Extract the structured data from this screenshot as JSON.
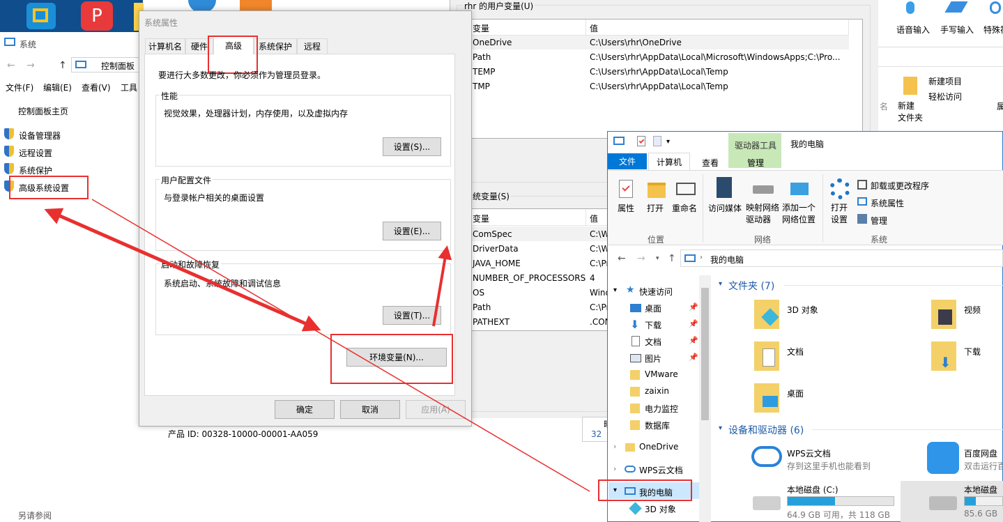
{
  "desktop": {
    "icons": [
      "desktop-app-1",
      "desktop-app-2",
      "desktop-app-3",
      "desktop-app-4",
      "desktop-app-5"
    ]
  },
  "ime": {
    "voice": "语音输入",
    "handwrite": "手写输入",
    "special": "特殊符"
  },
  "system_window": {
    "title": "系统",
    "address": "控制面板",
    "menu": [
      "文件(F)",
      "编辑(E)",
      "查看(V)",
      "工具"
    ],
    "home": "控制面板主页",
    "links": [
      "设备管理器",
      "远程设置",
      "系统保护",
      "高级系统设置"
    ],
    "product_id": "产品 ID: 00328-10000-00001-AA059",
    "see_also": "另请参阅"
  },
  "sysprops": {
    "title": "系统属性",
    "tabs": [
      "计算机名",
      "硬件",
      "高级",
      "系统保护",
      "远程"
    ],
    "admin_note": "要进行大多数更改，你必须作为管理员登录。",
    "perf": {
      "title": "性能",
      "desc": "视觉效果，处理器计划，内存使用，以及虚拟内存",
      "btn": "设置(S)..."
    },
    "profile": {
      "title": "用户配置文件",
      "desc": "与登录帐户相关的桌面设置",
      "btn": "设置(E)..."
    },
    "startup": {
      "title": "启动和故障恢复",
      "desc": "系统启动、系统故障和调试信息",
      "btn": "设置(T)..."
    },
    "env_btn": "环境变量(N)...",
    "ok": "确定",
    "cancel": "取消",
    "apply": "应用(A)"
  },
  "envvars": {
    "user_title": "rhr 的用户变量(U)",
    "col_var": "变量",
    "col_val": "值",
    "user_rows": [
      {
        "name": "OneDrive",
        "value": "C:\\Users\\rhr\\OneDrive"
      },
      {
        "name": "Path",
        "value": "C:\\Users\\rhr\\AppData\\Local\\Microsoft\\WindowsApps;C:\\Pro..."
      },
      {
        "name": "TEMP",
        "value": "C:\\Users\\rhr\\AppData\\Local\\Temp"
      },
      {
        "name": "TMP",
        "value": "C:\\Users\\rhr\\AppData\\Local\\Temp"
      }
    ],
    "sys_title": "系统变量(S)",
    "sys_rows": [
      {
        "name": "ComSpec",
        "value": "C:\\W"
      },
      {
        "name": "DriverData",
        "value": "C:\\W"
      },
      {
        "name": "JAVA_HOME",
        "value": "C:\\Pr"
      },
      {
        "name": "NUMBER_OF_PROCESSORS",
        "value": "4"
      },
      {
        "name": "OS",
        "value": "Wind"
      },
      {
        "name": "Path",
        "value": "C:\\Pr"
      },
      {
        "name": "PATHEXT",
        "value": ".CON"
      }
    ]
  },
  "bg_explorer": {
    "new_item": "新建项目",
    "easy_access": "轻松访问",
    "new_folder": "新建\n文件夹",
    "fragment": "名",
    "fragment2": "属"
  },
  "hidden_fragment": {
    "line1": "晒",
    "line2": "32"
  },
  "explorer": {
    "title": "我的电脑",
    "drive_tools": "驱动器工具",
    "ribbon_tabs": [
      "文件",
      "计算机",
      "查看",
      "管理"
    ],
    "groups": {
      "location": {
        "label": "位置",
        "items": [
          "属性",
          "打开",
          "重命名"
        ]
      },
      "network": {
        "label": "网络",
        "items": [
          "访问媒体",
          "映射网络\n驱动器",
          "添加一个\n网络位置"
        ]
      },
      "system": {
        "label": "系统",
        "open": "打开\n设置",
        "items": [
          "卸载或更改程序",
          "系统属性",
          "管理"
        ]
      }
    },
    "address": "我的电脑",
    "nav": {
      "quick": "快速访问",
      "pinned": [
        "桌面",
        "下载",
        "文档",
        "图片"
      ],
      "folders": [
        "VMware",
        "zaixin",
        "电力监控",
        "数据库"
      ],
      "onedrive": "OneDrive",
      "wps": "WPS云文档",
      "pc": "我的电脑",
      "obj3d": "3D 对象"
    },
    "folders_header": "文件夹 (7)",
    "folders": [
      "3D 对象",
      "视频",
      "文档",
      "下载",
      "桌面"
    ],
    "devices_header": "设备和驱动器 (6)",
    "devices": {
      "wps": {
        "name": "WPS云文档",
        "desc": "存到这里手机也能看到"
      },
      "baidu": {
        "name": "百度网盘",
        "desc": "双击运行百"
      },
      "c": {
        "name": "本地磁盘 (C:)",
        "info": "64.9 GB 可用，共 118 GB",
        "used": 0.45
      },
      "d": {
        "name": "本地磁盘",
        "info": "85.6 GB",
        "used": 0.3
      }
    }
  },
  "colors": {
    "accent": "#0078d7",
    "red": "#e8302f",
    "ribbon_tool": "#c8e8b8"
  }
}
